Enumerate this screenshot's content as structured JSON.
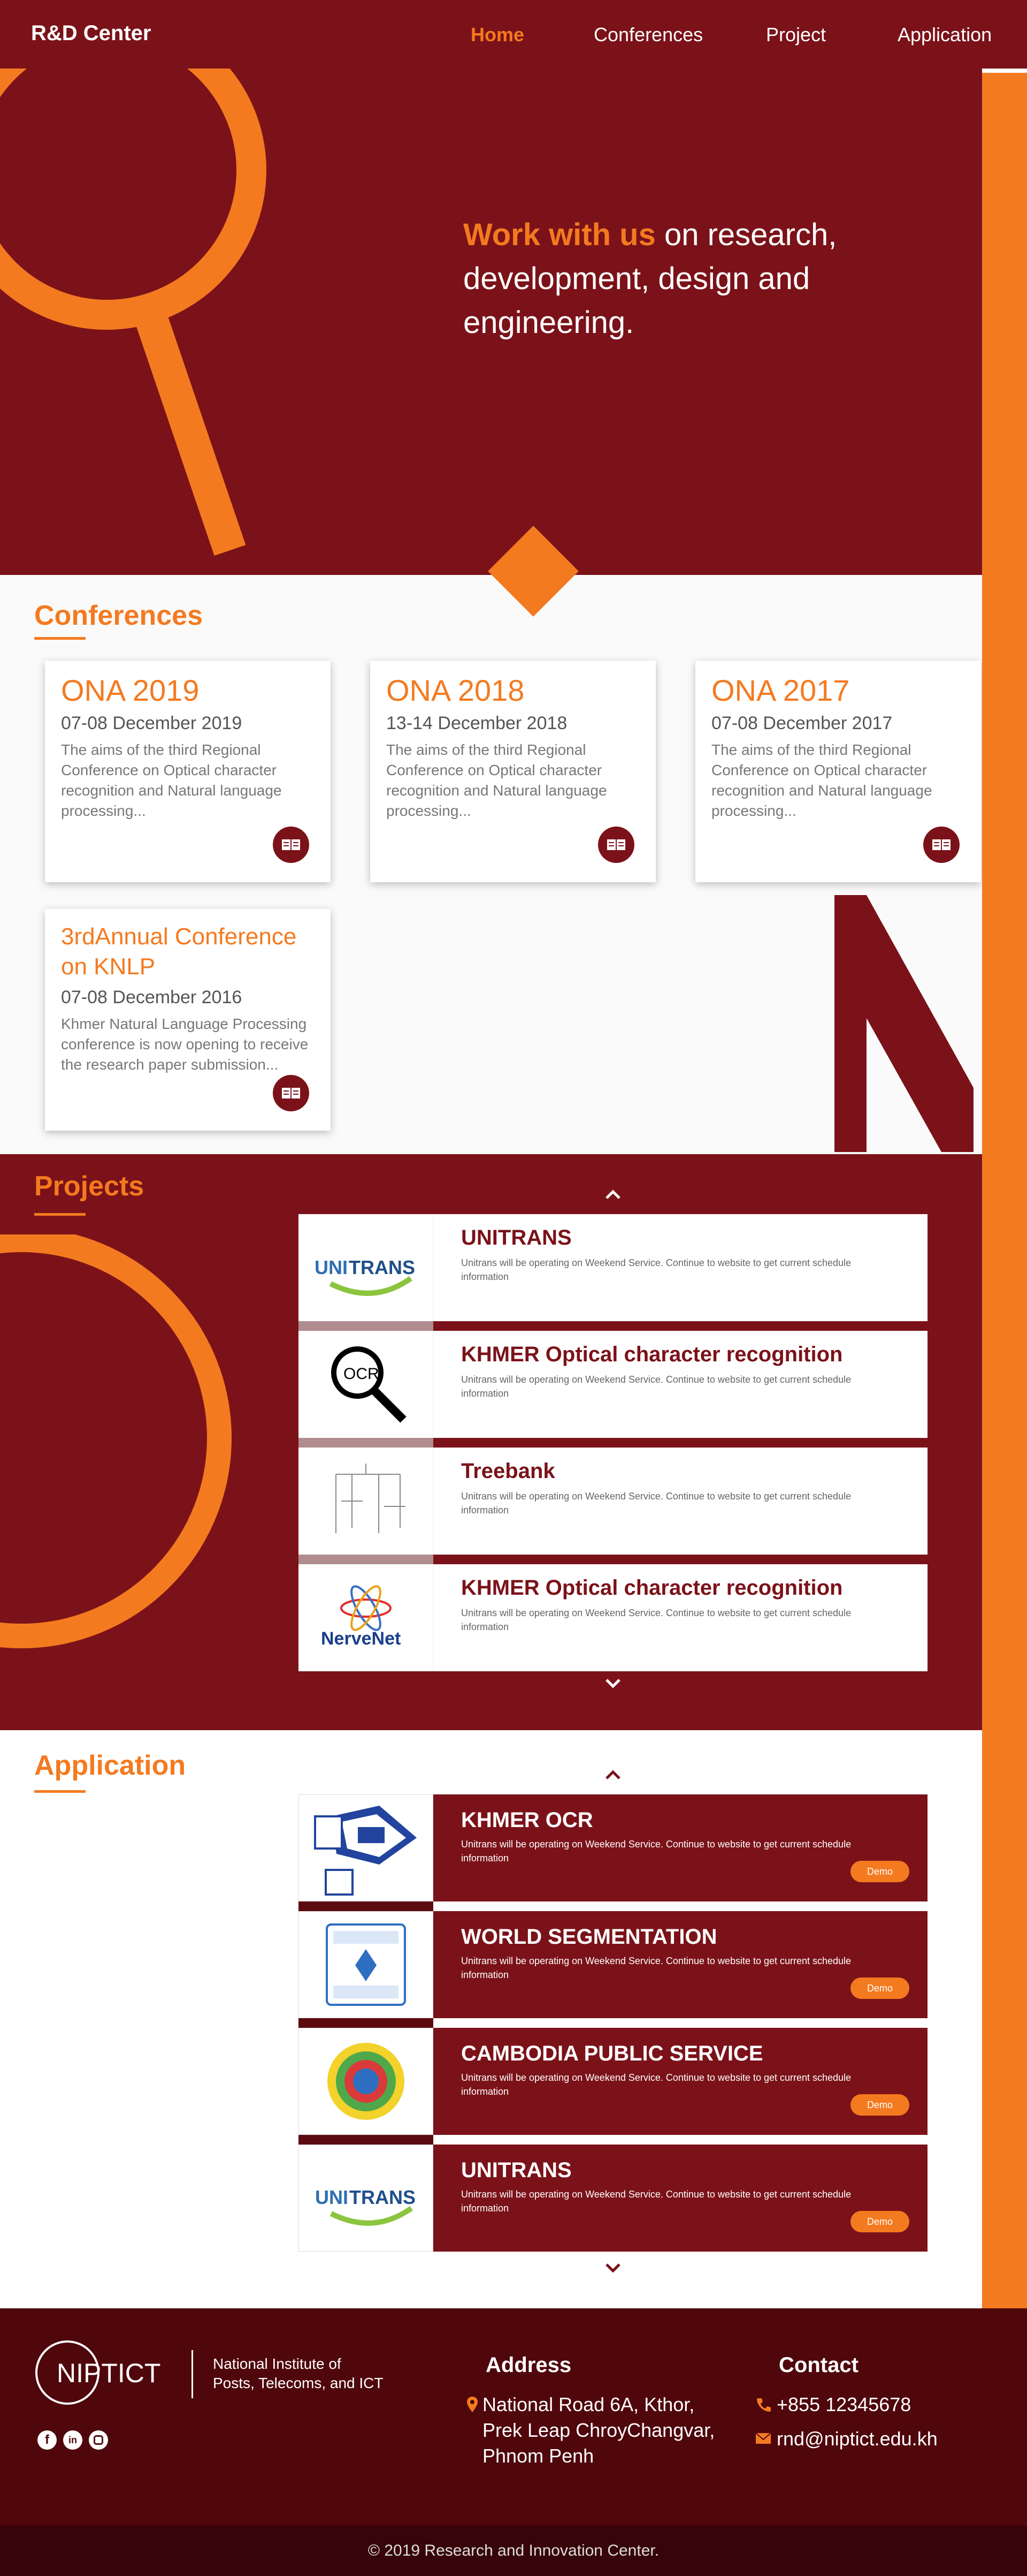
{
  "nav": {
    "brand": "R&D Center",
    "links": [
      "Home",
      "Conferences",
      "Project",
      "Application"
    ]
  },
  "hero": {
    "highlight": "Work with us",
    "rest": "on research, development, design and engineering."
  },
  "conferences": {
    "title": "Conferences",
    "cards": [
      {
        "title": "ONA 2019",
        "date": "07-08 December 2019",
        "desc": "The aims of the third Regional Conference on Optical character recognition and Natural language processing..."
      },
      {
        "title": "ONA 2018",
        "date": "13-14 December 2018",
        "desc": "The aims of the third Regional Conference on Optical character recognition and Natural language processing..."
      },
      {
        "title": "ONA 2017",
        "date": "07-08 December 2017",
        "desc": "The aims of the third Regional Conference on Optical character recognition and Natural language processing..."
      },
      {
        "title": "3rdAnnual Conference on KNLP",
        "date": "07-08 December 2016",
        "desc": "Khmer Natural Language Processing conference is now opening to receive the research paper submission..."
      }
    ]
  },
  "projects": {
    "title": "Projects",
    "items": [
      {
        "name": "UNITRANS",
        "desc": "Unitrans will be operating on Weekend Service. Continue to website to get current schedule information",
        "logo_text": "UNI TRANS"
      },
      {
        "name": "KHMER Optical character recognition",
        "desc": "Unitrans will be operating on Weekend Service. Continue to website to get current schedule information",
        "logo_text": "OCR"
      },
      {
        "name": "Treebank",
        "desc": "Unitrans will be operating on Weekend Service. Continue to website to get current schedule information",
        "logo_text": ""
      },
      {
        "name": "KHMER Optical character recognition",
        "desc": "Unitrans will be operating on Weekend Service. Continue to website to get current schedule information",
        "logo_text": "NerveNet"
      }
    ]
  },
  "application": {
    "title": "Application",
    "demo_label": "Demo",
    "items": [
      {
        "name": "KHMER OCR",
        "desc": "Unitrans will be operating on Weekend Service. Continue to website to get current schedule information"
      },
      {
        "name": "WORLD SEGMENTATION",
        "desc": "Unitrans will be operating on Weekend Service. Continue to website to get current schedule information"
      },
      {
        "name": "CAMBODIA PUBLIC SERVICE",
        "desc": "Unitrans will be operating on Weekend Service. Continue to website to get current schedule information"
      },
      {
        "name": "UNITRANS",
        "desc": "Unitrans will be operating on Weekend Service. Continue to website to get current schedule information",
        "logo_text": "UNI TRANS"
      }
    ]
  },
  "footer": {
    "logo": "NIPTICT",
    "org_line1": "National Institute of",
    "org_line2": "Posts, Telecoms, and ICT",
    "address_title": "Address",
    "address_line1": "National Road 6A, Kthor,",
    "address_line2": "Prek Leap ChroyChangvar,",
    "address_line3": "Phnom Penh",
    "contact_title": "Contact",
    "phone": "+855 12345678",
    "email": "rnd@niptict.edu.kh",
    "copyright": "© 2019 Research and Innovation Center."
  },
  "colors": {
    "maroon": "#7b1219",
    "orange": "#f47a20"
  }
}
